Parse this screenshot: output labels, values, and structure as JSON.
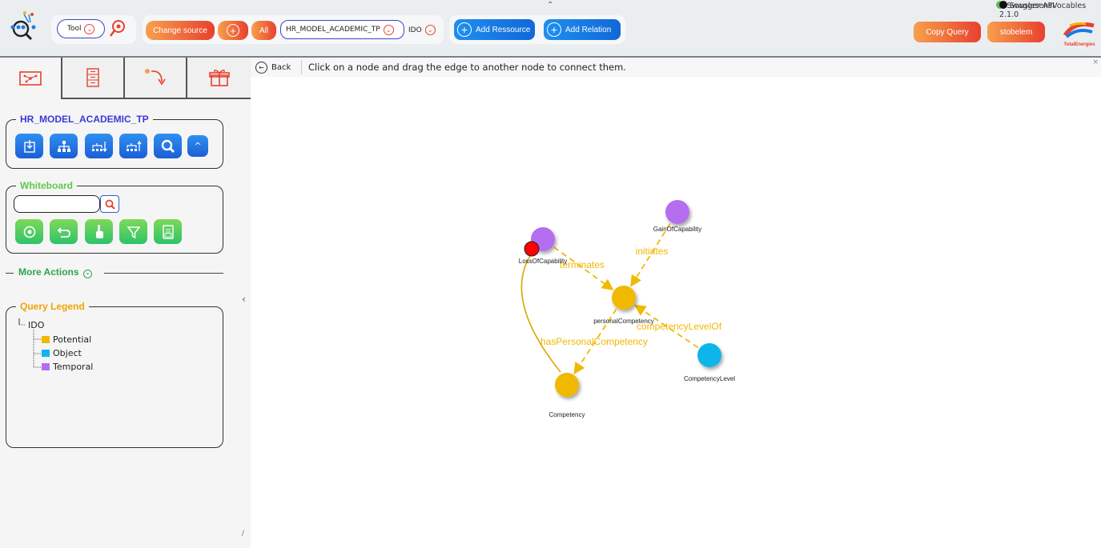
{
  "header": {
    "tool_label": "Tool",
    "change_source_label": "Change source",
    "all_label": "All",
    "source_name": "HR_MODEL_ACADEMIC_TP",
    "ido_label": "IDO",
    "add_resource_label": "Add Ressource",
    "add_relation_label": "Add Relation",
    "swagger_label": "Swagger API",
    "version_label": "SouslesensVocables 2.1.0",
    "copy_query_label": "Copy Query",
    "user_label": "stobelem",
    "brand_label": "TotalEnergies"
  },
  "left_panel": {
    "tabs": [
      "graph-tab",
      "data-tab",
      "path-tab",
      "box-tab"
    ],
    "source_section_title": "HR_MODEL_ACADEMIC_TP",
    "source_buttons": [
      "select",
      "hierarchy",
      "sort-down",
      "sort-up",
      "search",
      "collapse"
    ],
    "collapse_symbol": "^",
    "whiteboard_title": "Whiteboard",
    "whiteboard_search_value": "",
    "whiteboard_buttons": [
      "reload",
      "undo",
      "touch",
      "filter",
      "export"
    ],
    "more_actions_label": "More Actions",
    "query_legend_title": "Query Legend",
    "legend_tree": {
      "root": "IDO",
      "children": [
        {
          "label": "Potential",
          "color": "#f0b900"
        },
        {
          "label": "Object",
          "color": "#0db6ea"
        },
        {
          "label": "Temporal",
          "color": "#b46ef0"
        }
      ]
    }
  },
  "main": {
    "back_label": "Back",
    "message": "Click on a node and drag the edge to another node to connect them.",
    "close_symbol": "×"
  },
  "graph": {
    "nodes": [
      {
        "id": "gain",
        "label": "GainOfCapability",
        "color": "#b46ef0"
      },
      {
        "id": "loss",
        "label": "LossOfCapability",
        "color": "#b46ef0"
      },
      {
        "id": "pc",
        "label": "personalCompetency",
        "color": "#f0b900"
      },
      {
        "id": "cl",
        "label": "CompetencyLevel",
        "color": "#0db6ea"
      },
      {
        "id": "comp",
        "label": "Competency",
        "color": "#f0b900"
      }
    ],
    "edges": [
      {
        "from": "loss",
        "to": "pc",
        "label": "terminates"
      },
      {
        "from": "gain",
        "to": "pc",
        "label": "initiates"
      },
      {
        "from": "cl",
        "to": "pc",
        "label": "competencyLevelOf"
      },
      {
        "from": "pc",
        "to": "comp",
        "label": "hasPersonalCompetency"
      },
      {
        "from": "comp",
        "to": "loss",
        "label": ""
      }
    ],
    "edge_color": "#f0b900",
    "selection_marker_color": "#ff0000"
  }
}
